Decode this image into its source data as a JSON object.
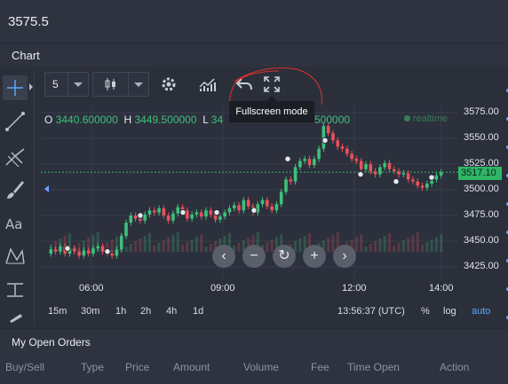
{
  "header": {
    "price": "3575.5"
  },
  "chart_section": {
    "title": "Chart"
  },
  "toolbar": {
    "interval_value": "5",
    "tooltip": "Fullscreen mode"
  },
  "ohlc": {
    "o_label": "O",
    "o_value": "3440.600000",
    "h_label": "H",
    "h_value": "3449.500000",
    "l_label": "L",
    "l_value": "34",
    "c_value": "500000"
  },
  "realtime_label": "realtime",
  "yaxis": {
    "ticks": [
      "3575.00",
      "3550.00",
      "3525.00",
      "3500.00",
      "3475.00",
      "3450.00",
      "3425.00"
    ],
    "current_price": "3517.10"
  },
  "xaxis": {
    "ticks": [
      "06:00",
      "09:00",
      "12:00",
      "14:00"
    ]
  },
  "nav_buttons": [
    "‹",
    "−",
    "↻",
    "+",
    "›"
  ],
  "timeframes": {
    "items": [
      "15m",
      "30m",
      "1h",
      "2h",
      "4h",
      "1d"
    ],
    "clock": "13:56:37 (UTC)",
    "pct": "%",
    "log": "log",
    "auto": "auto"
  },
  "orders": {
    "title": "My Open Orders",
    "columns": [
      "Buy/Sell",
      "Type",
      "Price",
      "Amount",
      "Volume",
      "Fee",
      "Time Open",
      "Action"
    ]
  },
  "colors": {
    "up": "#3ec07a",
    "down": "#e8525a",
    "accent": "#5aa8ff",
    "price_tag": "#2fb567",
    "annotation": "#e03030"
  }
}
